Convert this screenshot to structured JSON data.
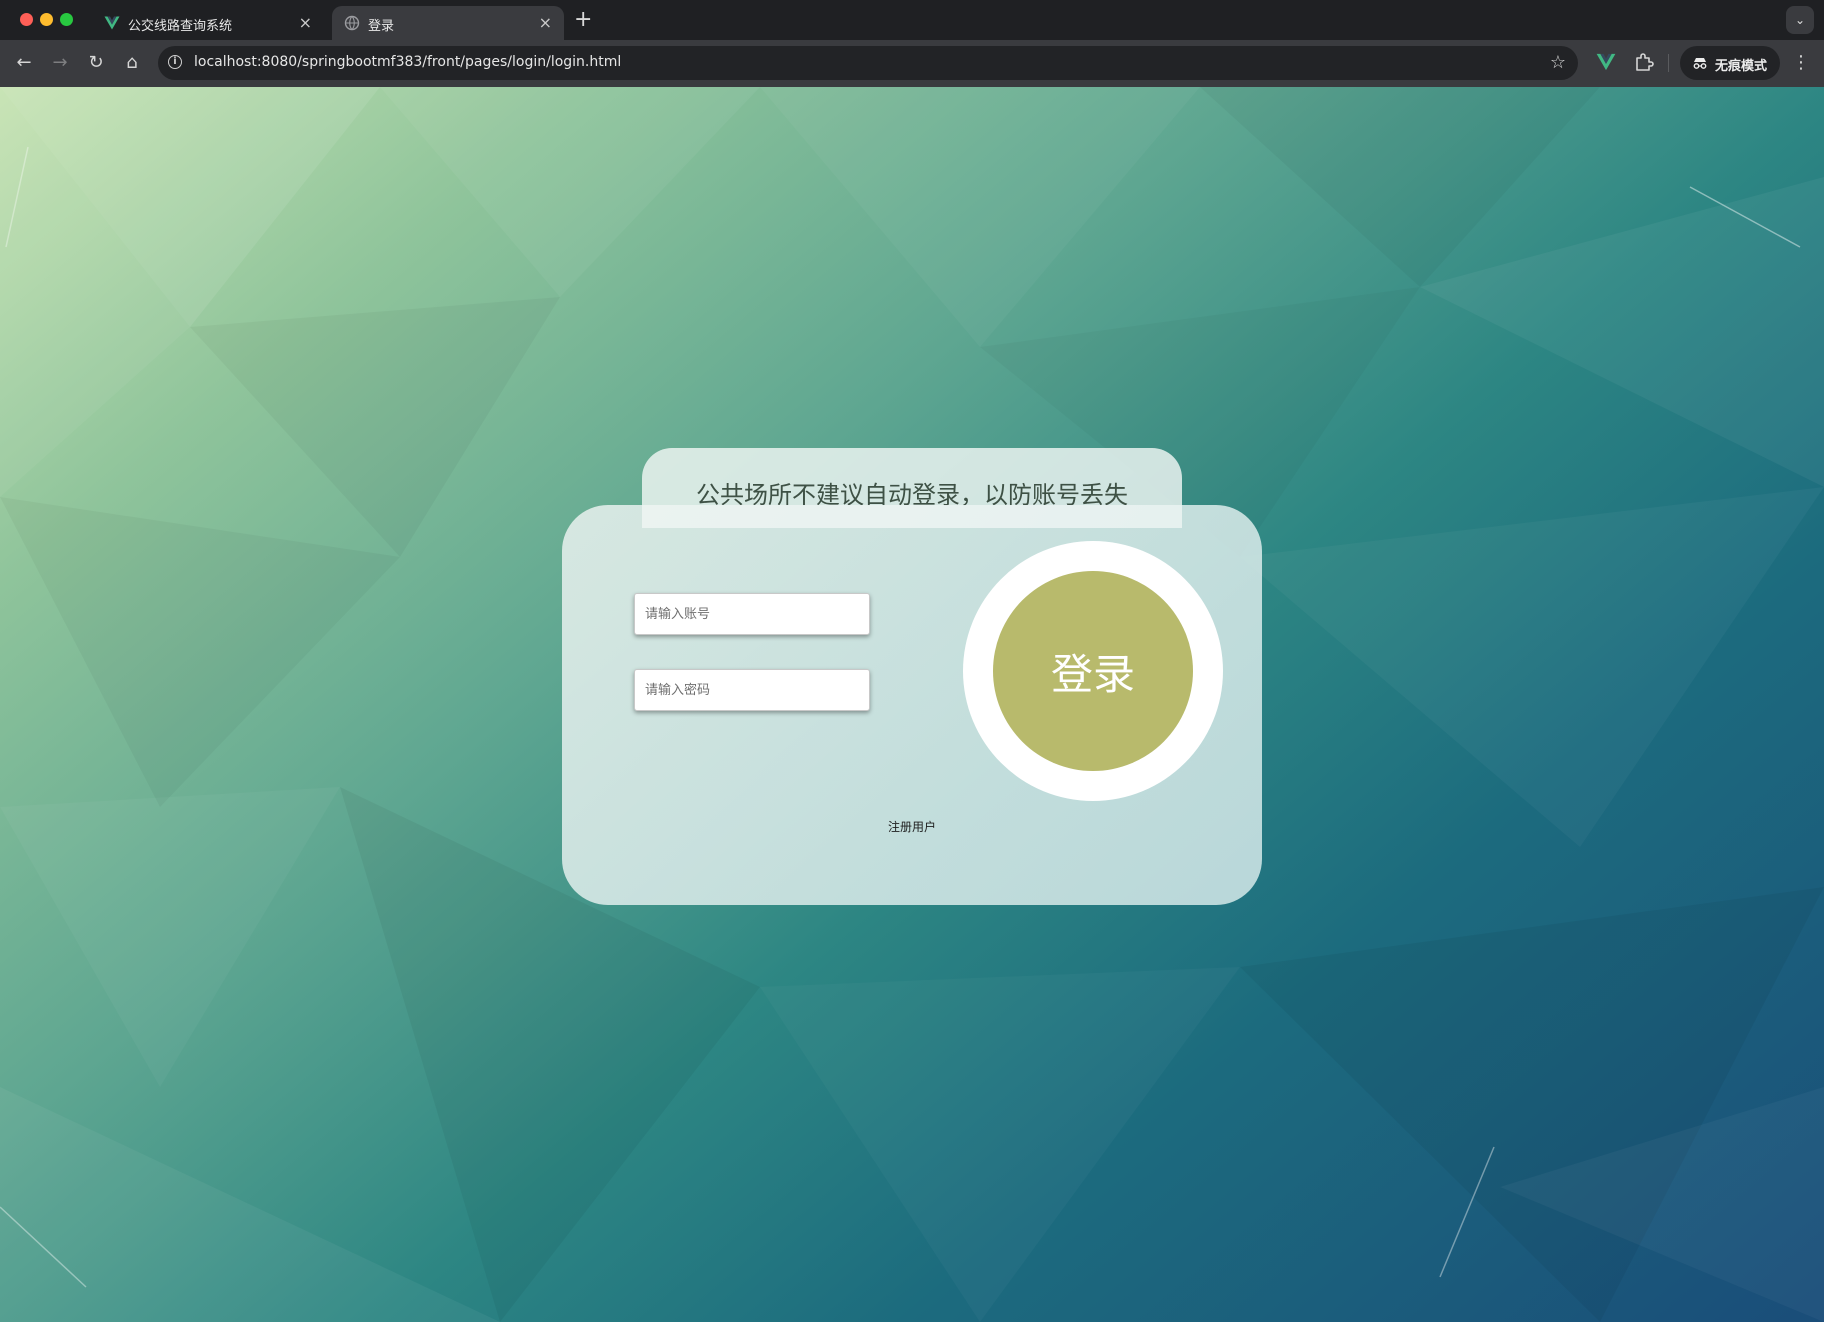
{
  "browser": {
    "tabs": [
      {
        "title": "公交线路查询系统",
        "active": false,
        "favicon": "vue-logo-icon"
      },
      {
        "title": "登录",
        "active": true,
        "favicon": "globe-icon"
      }
    ],
    "address": "localhost:8080/springbootmf383/front/pages/login/login.html",
    "incognito_label": "无痕模式"
  },
  "login": {
    "notice": "公共场所不建议自动登录，以防账号丢失",
    "account_placeholder": "请输入账号",
    "account_value": "",
    "password_placeholder": "请输入密码",
    "password_value": "",
    "submit_label": "登录",
    "register_label": "注册用户"
  },
  "colors": {
    "login_button": "#b8ba6c",
    "notice_text": "#3e5145",
    "background_top": "#c6e3b2",
    "background_bottom": "#1a4d79"
  }
}
